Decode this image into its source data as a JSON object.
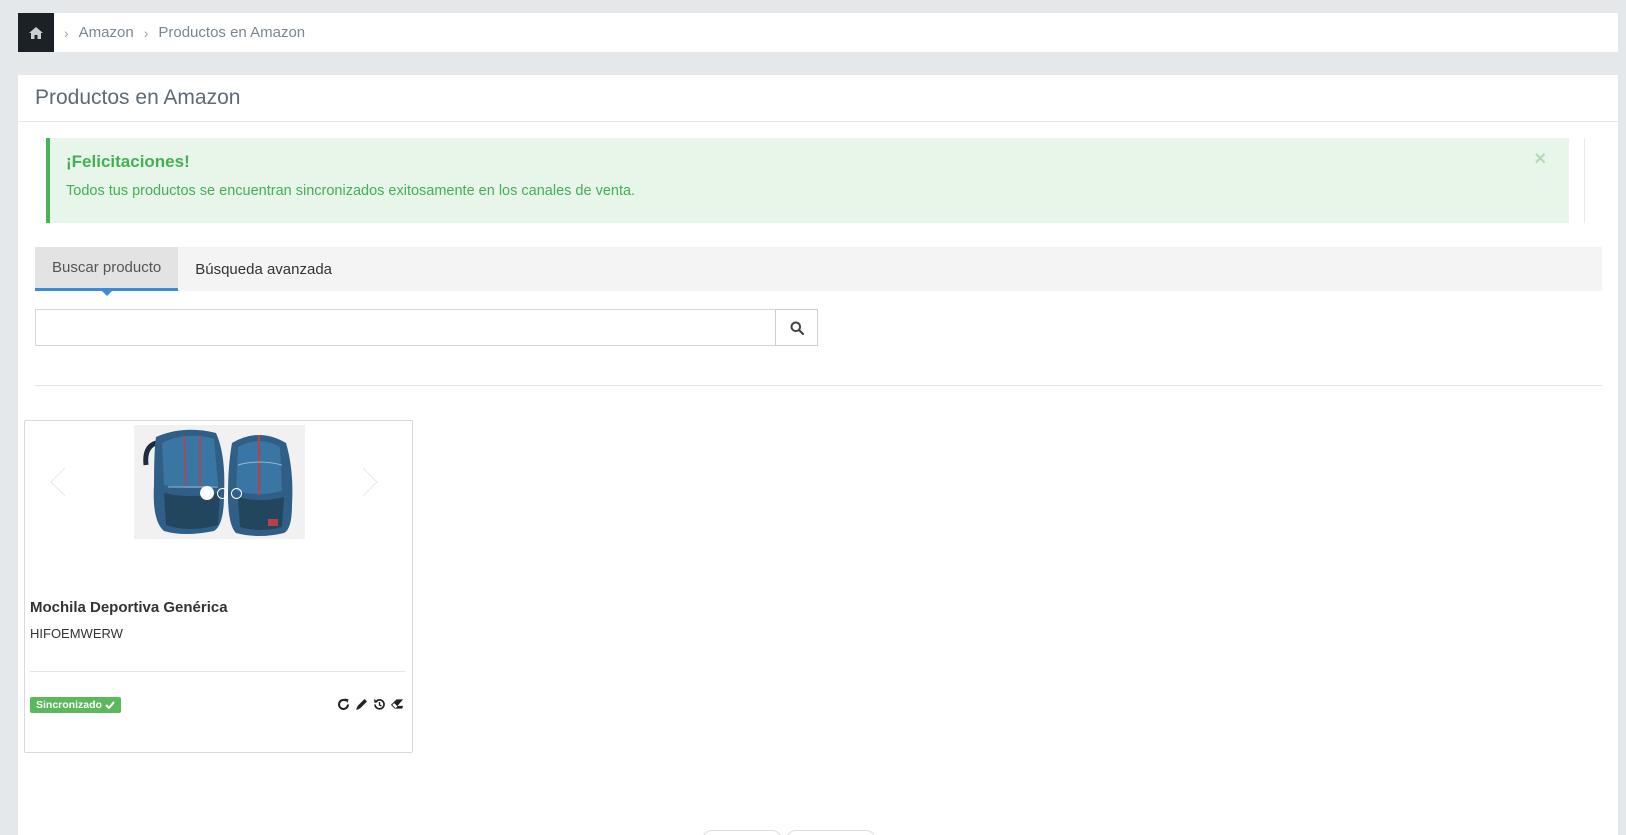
{
  "breadcrumb": {
    "home_icon": "home-icon",
    "items": [
      "Amazon",
      "Productos en Amazon"
    ]
  },
  "panel": {
    "title": "Productos en Amazon"
  },
  "alert": {
    "title": "¡Felicitaciones!",
    "message": "Todos tus productos se encuentran sincronizados exitosamente en los canales de venta.",
    "close": "×",
    "color": "#45b053"
  },
  "tabs": [
    {
      "label": "Buscar producto",
      "active": true
    },
    {
      "label": "Búsqueda avanzada",
      "active": false
    }
  ],
  "search": {
    "value": "",
    "placeholder": "",
    "icon": "search-icon"
  },
  "product": {
    "name": "Mochila Deportiva Genérica",
    "sku": "HIFOEMWERW",
    "status": "Sincronizado",
    "status_color": "#5cb85c",
    "image_count": 3,
    "active_image": 1,
    "actions": [
      "refresh-icon",
      "pencil-icon",
      "history-icon",
      "eraser-icon"
    ]
  }
}
